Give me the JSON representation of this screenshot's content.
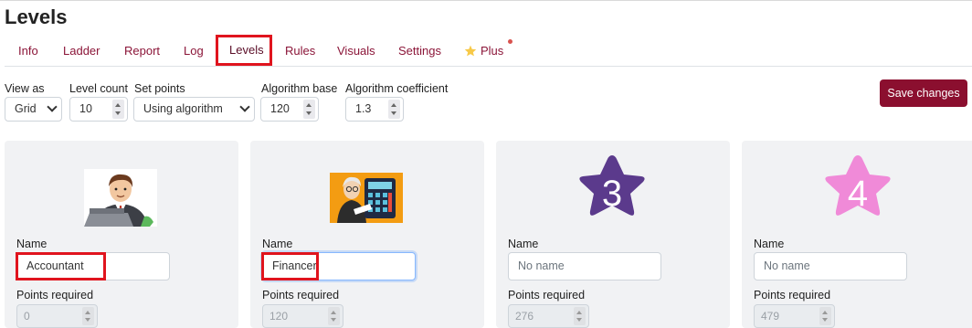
{
  "page": {
    "title": "Levels"
  },
  "tabs": [
    {
      "label": "Info"
    },
    {
      "label": "Ladder"
    },
    {
      "label": "Report"
    },
    {
      "label": "Log"
    },
    {
      "label": "Levels",
      "active": true
    },
    {
      "label": "Rules"
    },
    {
      "label": "Visuals"
    },
    {
      "label": "Settings"
    },
    {
      "label": "Plus",
      "icon": "star-icon",
      "notification_dot": true
    }
  ],
  "toolbar": {
    "view_as": {
      "label": "View as",
      "value": "Grid"
    },
    "level_count": {
      "label": "Level count",
      "value": "10"
    },
    "set_points": {
      "label": "Set points",
      "value": "Using algorithm"
    },
    "algorithm_base": {
      "label": "Algorithm base",
      "value": "120"
    },
    "algorithm_coefficient": {
      "label": "Algorithm coefficient",
      "value": "1.3"
    },
    "save_label": "Save changes"
  },
  "levels": [
    {
      "image": "accountant-avatar",
      "name_label": "Name",
      "name_value": "Accountant",
      "name_placeholder": "No name",
      "points_label": "Points required",
      "points_value": "0"
    },
    {
      "image": "financer-avatar",
      "name_label": "Name",
      "name_value": "Financer",
      "name_placeholder": "No name",
      "points_label": "Points required",
      "points_value": "120"
    },
    {
      "image": "star-badge",
      "badge_number": "3",
      "badge_color": "#5b3a8c",
      "name_label": "Name",
      "name_value": "",
      "name_placeholder": "No name",
      "points_label": "Points required",
      "points_value": "276"
    },
    {
      "image": "star-badge",
      "badge_number": "4",
      "badge_color": "#f08ad8",
      "name_label": "Name",
      "name_value": "",
      "name_placeholder": "No name",
      "points_label": "Points required",
      "points_value": "479"
    }
  ],
  "colors": {
    "accent": "#8b0f2f",
    "tab_text": "#8b1538",
    "highlight": "#e0141e",
    "card_bg": "#f1f2f4"
  }
}
